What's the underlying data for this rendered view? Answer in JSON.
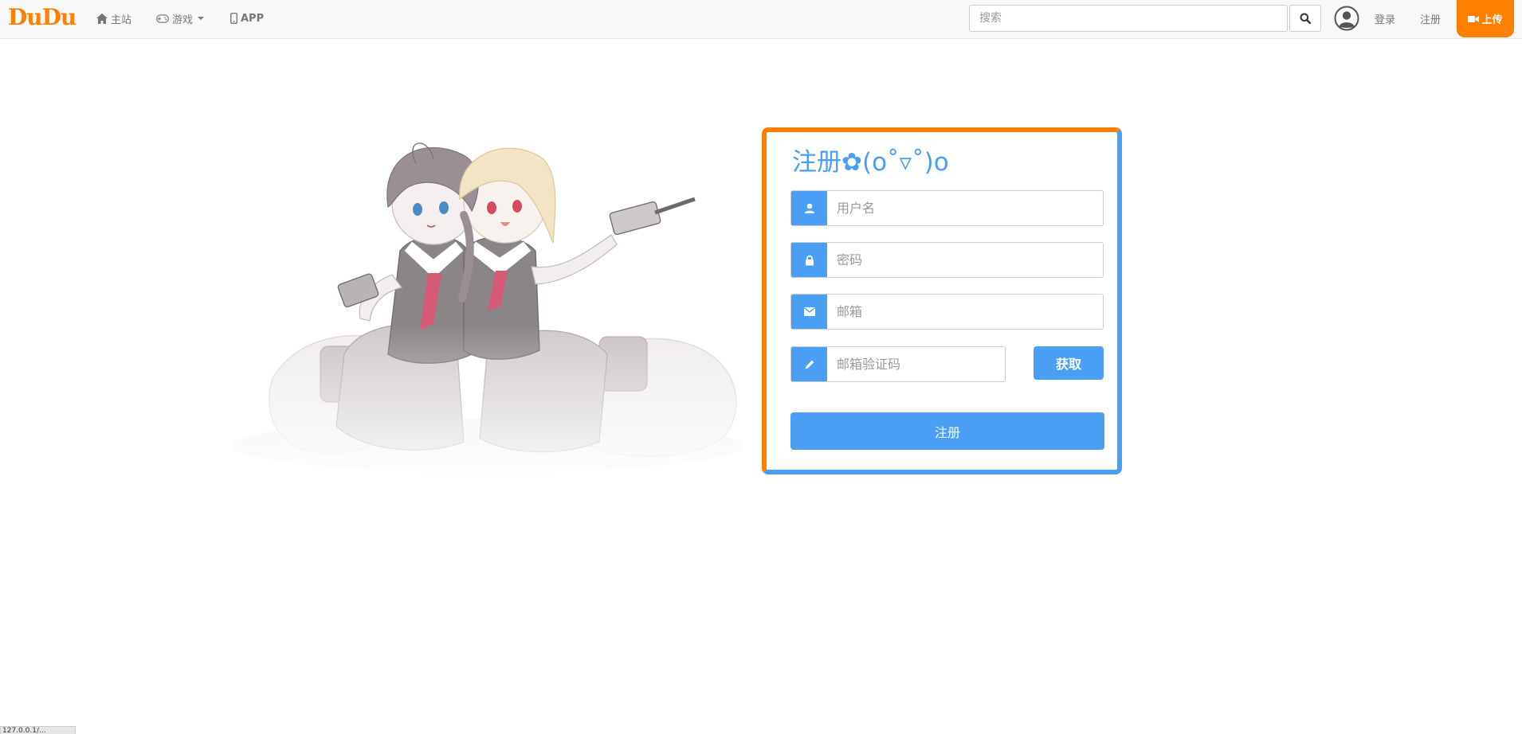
{
  "nav": {
    "brand": "DuDu",
    "home": "主站",
    "games": "游戏",
    "app": "APP",
    "search_placeholder": "搜索",
    "login": "登录",
    "register": "注册",
    "upload": "上传"
  },
  "form": {
    "title": "注册✿(o˚▿˚)o",
    "username_placeholder": "用户名",
    "password_placeholder": "密码",
    "email_placeholder": "邮箱",
    "code_placeholder": "邮箱验证码",
    "get_code": "获取",
    "submit": "注册"
  },
  "status": {
    "url": "127.0.0.1/..."
  },
  "colors": {
    "brand_orange": "#ff7f00",
    "accent_blue": "#4a9ff5",
    "navbar_bg": "#f8f8f8"
  },
  "icons": [
    "home-icon",
    "gamepad-icon",
    "mobile-icon",
    "search-icon",
    "user-avatar-icon",
    "video-camera-icon",
    "user-icon",
    "lock-icon",
    "envelope-icon",
    "pencil-icon"
  ]
}
